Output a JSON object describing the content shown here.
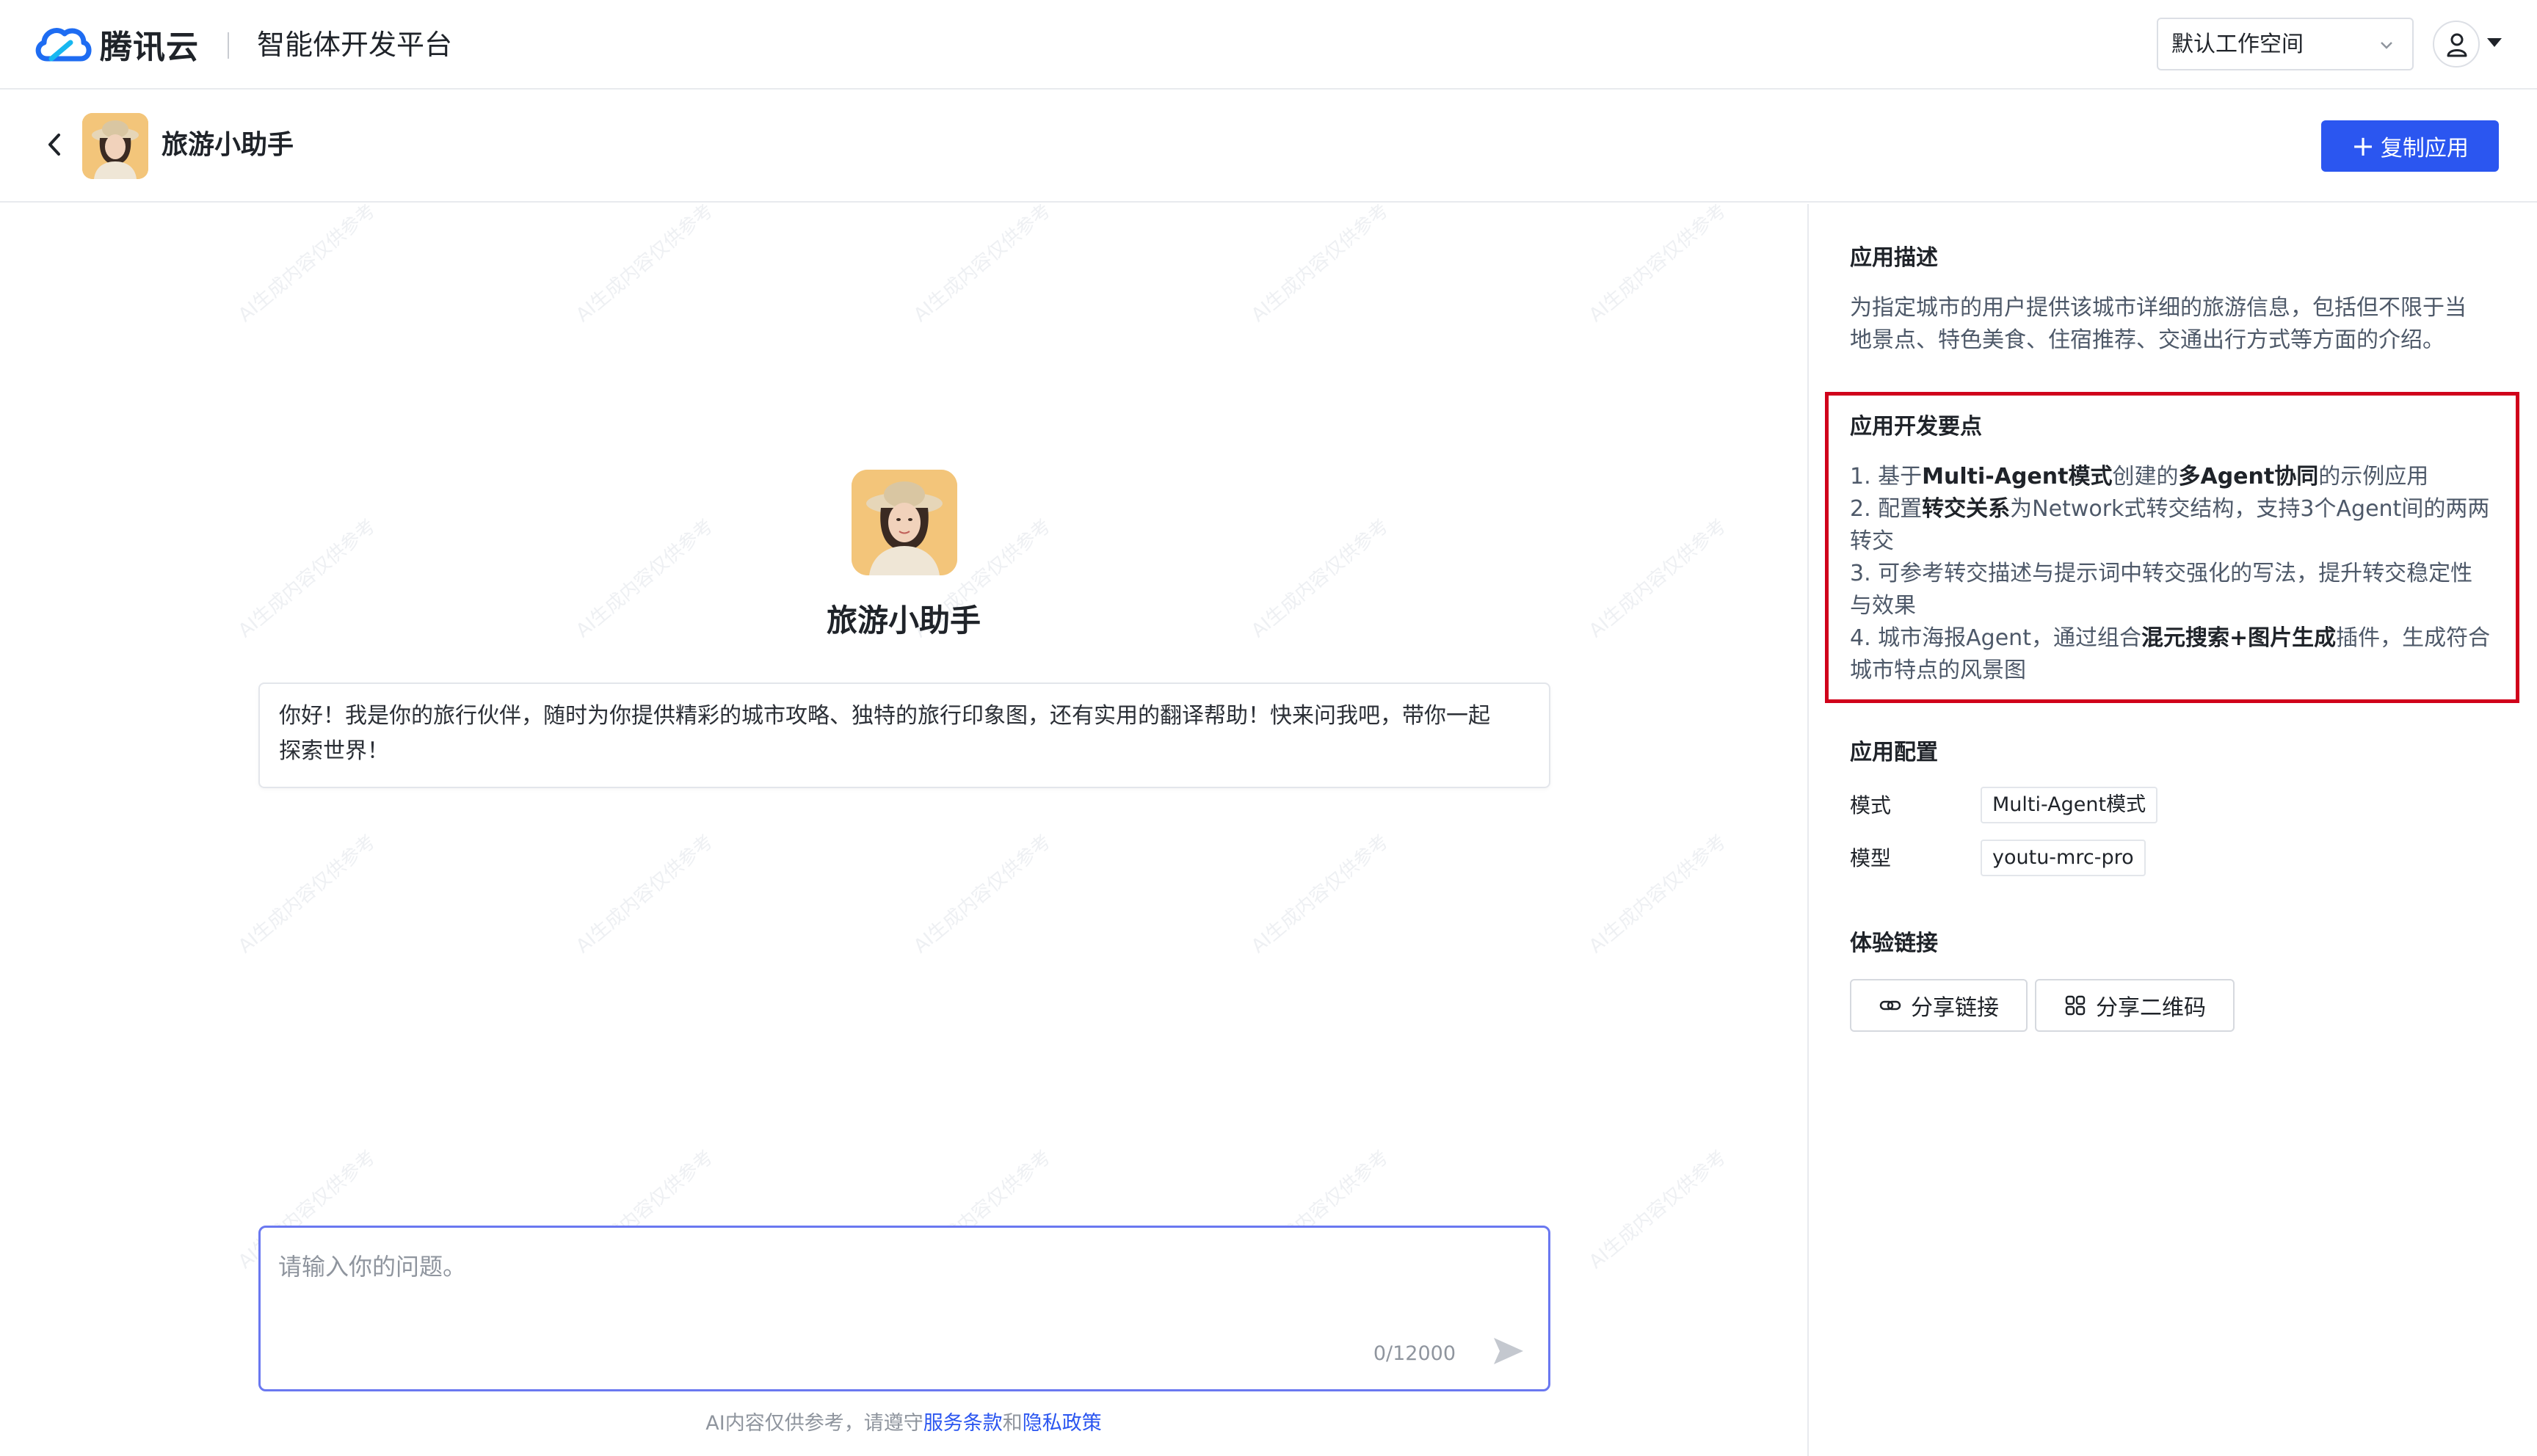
{
  "topbar": {
    "brand": "腾讯云",
    "platform_title": "智能体开发平台",
    "workspace_label": "默认工作空间"
  },
  "app_header": {
    "app_name": "旅游小助手",
    "copy_button": "复制应用"
  },
  "chat": {
    "assistant_name": "旅游小助手",
    "greeting_line1": "你好！我是你的旅行伙伴，随时为你提供精彩的城市攻略、独特的旅行印象图，还有实用的翻译帮助！快来问我吧，带你一起",
    "greeting_line2": "探索世界！",
    "input_placeholder": "请输入你的问题。",
    "char_counter": "0/12000",
    "disclaimer_prefix": "AI内容仅供参考，请遵守",
    "terms_link": "服务条款",
    "disclaimer_and": "和",
    "privacy_link": "隐私政策",
    "watermark_text": "AI生成内容仅供参考"
  },
  "sidebar": {
    "description_title": "应用描述",
    "description_line1": "为指定城市的用户提供该城市详细的旅游信息，包括但不限于当",
    "description_line2": "地景点、特色美食、住宿推荐、交通出行方式等方面的介绍。",
    "dev_points_title": "应用开发要点",
    "dev_points": {
      "p1_a": "1. 基于",
      "p1_b": "Multi-Agent模式",
      "p1_c": "创建的",
      "p1_d": "多Agent协同",
      "p1_e": "的示例应用",
      "p2_a": "2. 配置",
      "p2_b": "转交关系",
      "p2_c": "为Network式转交结构，支持3个Agent间的两两",
      "p2_d": "转交",
      "p3_a": "3. 可参考转交描述与提示词中转交强化的写法，提升转交稳定性",
      "p3_b": "与效果",
      "p4_a": "4. 城市海报Agent，通过组合",
      "p4_b": "混元搜索+图片生成",
      "p4_c": "插件，生成符合",
      "p4_d": "城市特点的风景图"
    },
    "config_title": "应用配置",
    "config": {
      "mode_label": "模式",
      "mode_value": "Multi-Agent模式",
      "model_label": "模型",
      "model_value": "youtu-mrc-pro"
    },
    "experience_title": "体验链接",
    "share_link": "分享链接",
    "share_qr": "分享二维码"
  },
  "colors": {
    "primary": "#2b56f0",
    "highlight_border": "#d0021b",
    "input_border": "#6a78f0"
  },
  "icons": [
    "cloud-logo-icon",
    "chevron-down-icon",
    "user-icon",
    "back-arrow-icon",
    "plus-icon",
    "send-icon",
    "link-icon",
    "qrcode-icon"
  ]
}
